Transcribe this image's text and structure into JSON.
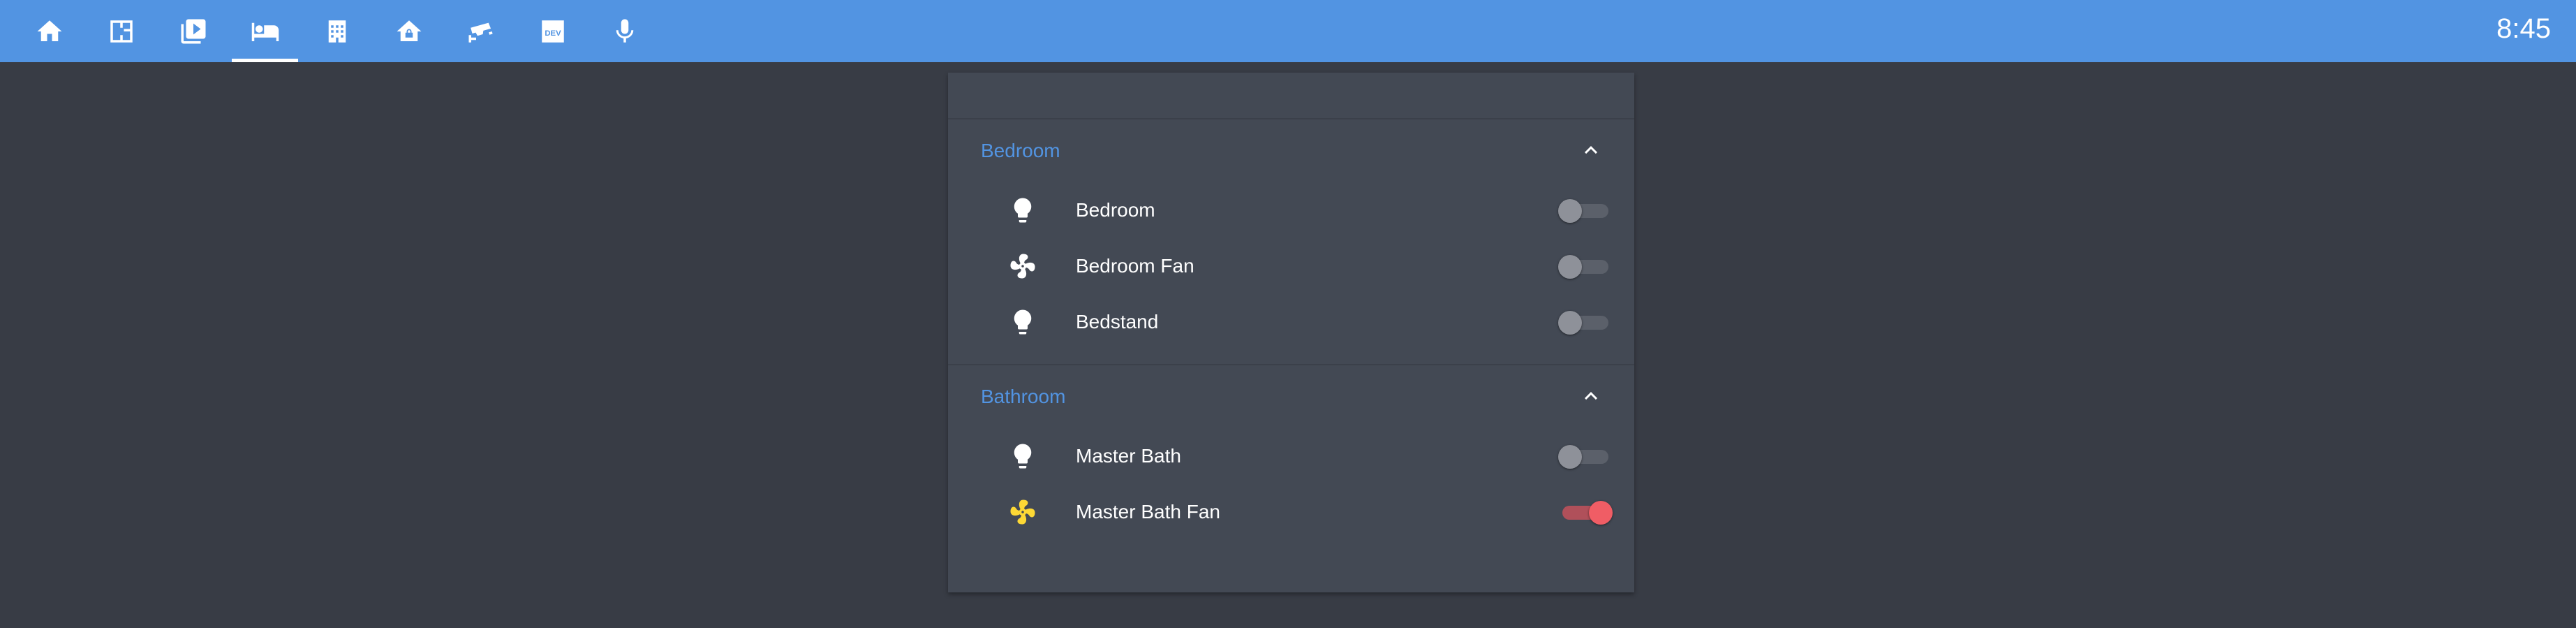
{
  "topbar": {
    "color": "#5294e2",
    "clock": "8:45",
    "tabs": [
      {
        "icon": "home-icon",
        "active": false
      },
      {
        "icon": "floorplan-icon",
        "active": false
      },
      {
        "icon": "media-library-icon",
        "active": false
      },
      {
        "icon": "bed-icon",
        "active": true
      },
      {
        "icon": "building-icon",
        "active": false
      },
      {
        "icon": "home-lock-icon",
        "active": false
      },
      {
        "icon": "cctv-icon",
        "active": false
      },
      {
        "icon": "dev-icon",
        "active": false
      },
      {
        "icon": "microphone-icon",
        "active": false
      }
    ]
  },
  "card": {
    "groups": [
      {
        "title": "Bedroom",
        "expanded": true,
        "entities": [
          {
            "name": "Bedroom",
            "icon": "lightbulb-icon",
            "state": "off"
          },
          {
            "name": "Bedroom Fan",
            "icon": "fan-icon",
            "state": "off"
          },
          {
            "name": "Bedstand",
            "icon": "lightbulb-icon",
            "state": "off"
          }
        ]
      },
      {
        "title": "Bathroom",
        "expanded": true,
        "entities": [
          {
            "name": "Master Bath",
            "icon": "lightbulb-icon",
            "state": "off"
          },
          {
            "name": "Master Bath Fan",
            "icon": "fan-icon",
            "state": "on"
          }
        ]
      }
    ]
  },
  "colors": {
    "accent": "#5294e2",
    "background": "#383c45",
    "card": "#434954",
    "toggle_on": "#f05d65",
    "icon_active": "#fdd835"
  }
}
